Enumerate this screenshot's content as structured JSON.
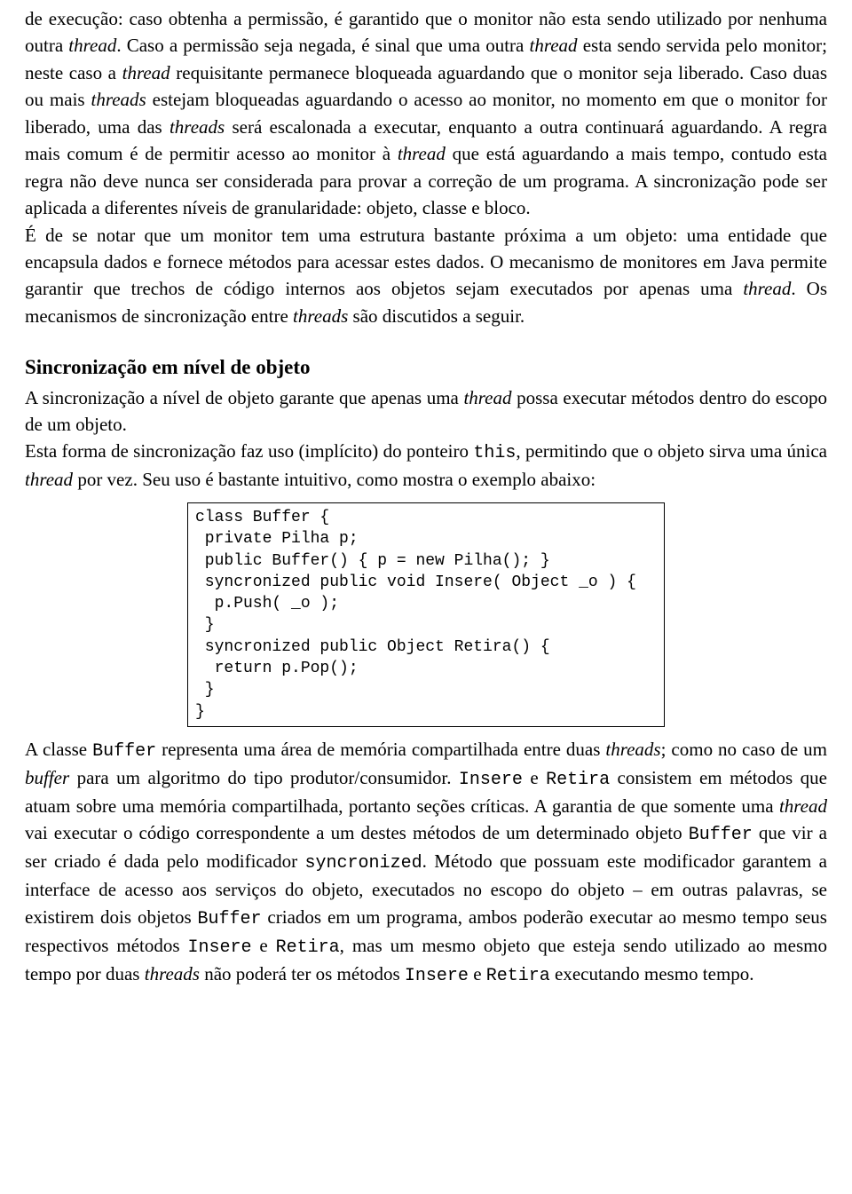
{
  "paragraphs": {
    "p1": "de execução: caso obtenha a permissão, é garantido que o monitor não esta sendo utilizado por nenhuma outra thread. Caso a permissão seja negada, é sinal que uma outra thread esta sendo servida pelo monitor; neste caso a thread requisitante permanece bloqueada aguardando que o monitor seja liberado. Caso duas ou mais threads estejam bloqueadas aguardando o acesso ao monitor, no momento em que o monitor for liberado, uma das threads será escalonada a executar, enquanto a outra continuará aguardando. A regra mais comum é de permitir acesso ao monitor à thread que está aguardando a mais tempo, contudo esta regra não deve nunca ser considerada para provar a correção de um programa. A sincronização pode ser aplicada a diferentes níveis de granularidade: objeto, classe e bloco.",
    "p2": "É de se notar que um monitor tem uma estrutura bastante próxima a um objeto: uma entidade que encapsula dados e fornece métodos para acessar estes dados. O mecanismo de monitores em Java permite garantir que trechos de código internos aos objetos sejam executados por apenas uma thread. Os mecanismos de sincronização entre threads são discutidos a seguir.",
    "heading": "Sincronização em nível de objeto",
    "p3": "A sincronização a nível de objeto garante que apenas uma thread possa executar métodos dentro do escopo de um objeto.",
    "p4": "Esta forma de sincronização faz uso (implícito) do ponteiro this, permitindo que o objeto sirva uma única thread por vez. Seu uso é bastante intuitivo, como mostra o exemplo abaixo:",
    "p5": "A classe Buffer representa uma área de memória compartilhada entre duas threads; como no caso de um buffer para um algoritmo do tipo produtor/consumidor. Insere e Retira consistem em métodos que atuam sobre uma memória compartilhada, portanto seções críticas. A garantia de que somente uma thread vai executar o código correspondente a um destes métodos de um determinado objeto Buffer que vir a ser criado é dada pelo modificador syncronized. Método que possuam este modificador garantem a interface de acesso aos serviços do objeto, executados no escopo do objeto – em outras palavras, se existirem dois objetos Buffer criados em um programa, ambos poderão executar ao mesmo tempo seus respectivos métodos Insere e Retira, mas um mesmo objeto que esteja sendo utilizado ao mesmo tempo por duas threads não poderá ter os métodos Insere e Retira executando mesmo tempo."
  },
  "code": "class Buffer {\n private Pilha p;\n public Buffer() { p = new Pilha(); }\n syncronized public void Insere( Object _o ) {\n  p.Push( _o );\n }\n syncronized public Object Retira() {\n  return p.Pop();\n }\n}",
  "italic_terms": [
    "thread",
    "threads",
    "buffer"
  ],
  "tt_terms": [
    "this",
    "Buffer",
    "Insere",
    "Retira",
    "syncronized"
  ]
}
